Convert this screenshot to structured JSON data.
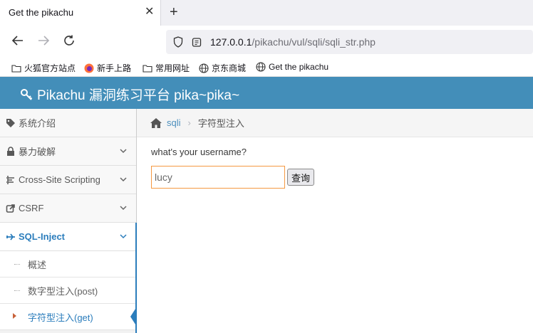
{
  "browser": {
    "tab_title": "Get the pikachu",
    "tab_close": "✕",
    "new_tab": "+",
    "url_host": "127.0.0.1",
    "url_path": "/pikachu/vul/sqli/sqli_str.php",
    "bookmarks": [
      "火狐官方站点",
      "新手上路",
      "常用网址",
      "京东商城",
      "Get the pikachu"
    ]
  },
  "site": {
    "title": "Pikachu 漏洞练习平台 pika~pika~",
    "header_color": "#438eb9"
  },
  "sidebar": {
    "items": [
      {
        "label": "系统介绍",
        "icon": "tags-icon"
      },
      {
        "label": "暴力破解",
        "icon": "lock-icon"
      },
      {
        "label": "Cross-Site Scripting",
        "icon": "list-icon"
      },
      {
        "label": "CSRF",
        "icon": "share-icon"
      },
      {
        "label": "SQL-Inject",
        "icon": "plane-icon"
      }
    ],
    "sub_items": [
      "概述",
      "数字型注入(post)",
      "字符型注入(get)"
    ]
  },
  "breadcrumb": {
    "link": "sqli",
    "current": "字符型注入"
  },
  "form": {
    "question": "what's your username?",
    "input_value": "lucy",
    "submit_label": "查询"
  },
  "colors": {
    "accent": "#2b7dbc",
    "input_focus_border": "#f59942"
  }
}
